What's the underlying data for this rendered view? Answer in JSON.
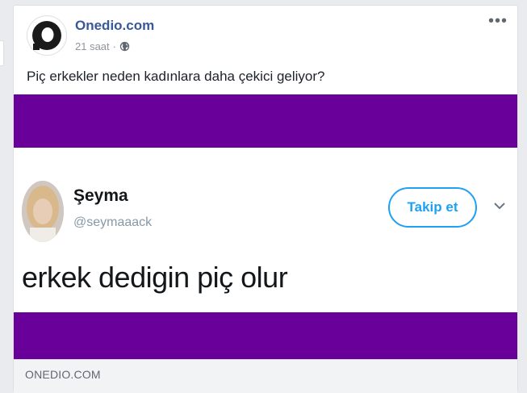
{
  "post": {
    "page_name": "Onedio.com",
    "timestamp": "21 saat",
    "separator": "·",
    "privacy_icon": "globe-icon",
    "more_icon": "more-options-icon",
    "more_label": "•••",
    "text": "Piç erkekler neden kadınlara daha çekici geliyor?"
  },
  "tweet": {
    "name": "Şeyma",
    "handle": "@seymaaack",
    "follow_label": "Takip et",
    "text": "erkek dedigin piç olur"
  },
  "link": {
    "domain": "ONEDIO.COM"
  },
  "colors": {
    "band": "#680099",
    "link_blue": "#385898",
    "twitter_blue": "#1da1f2"
  }
}
